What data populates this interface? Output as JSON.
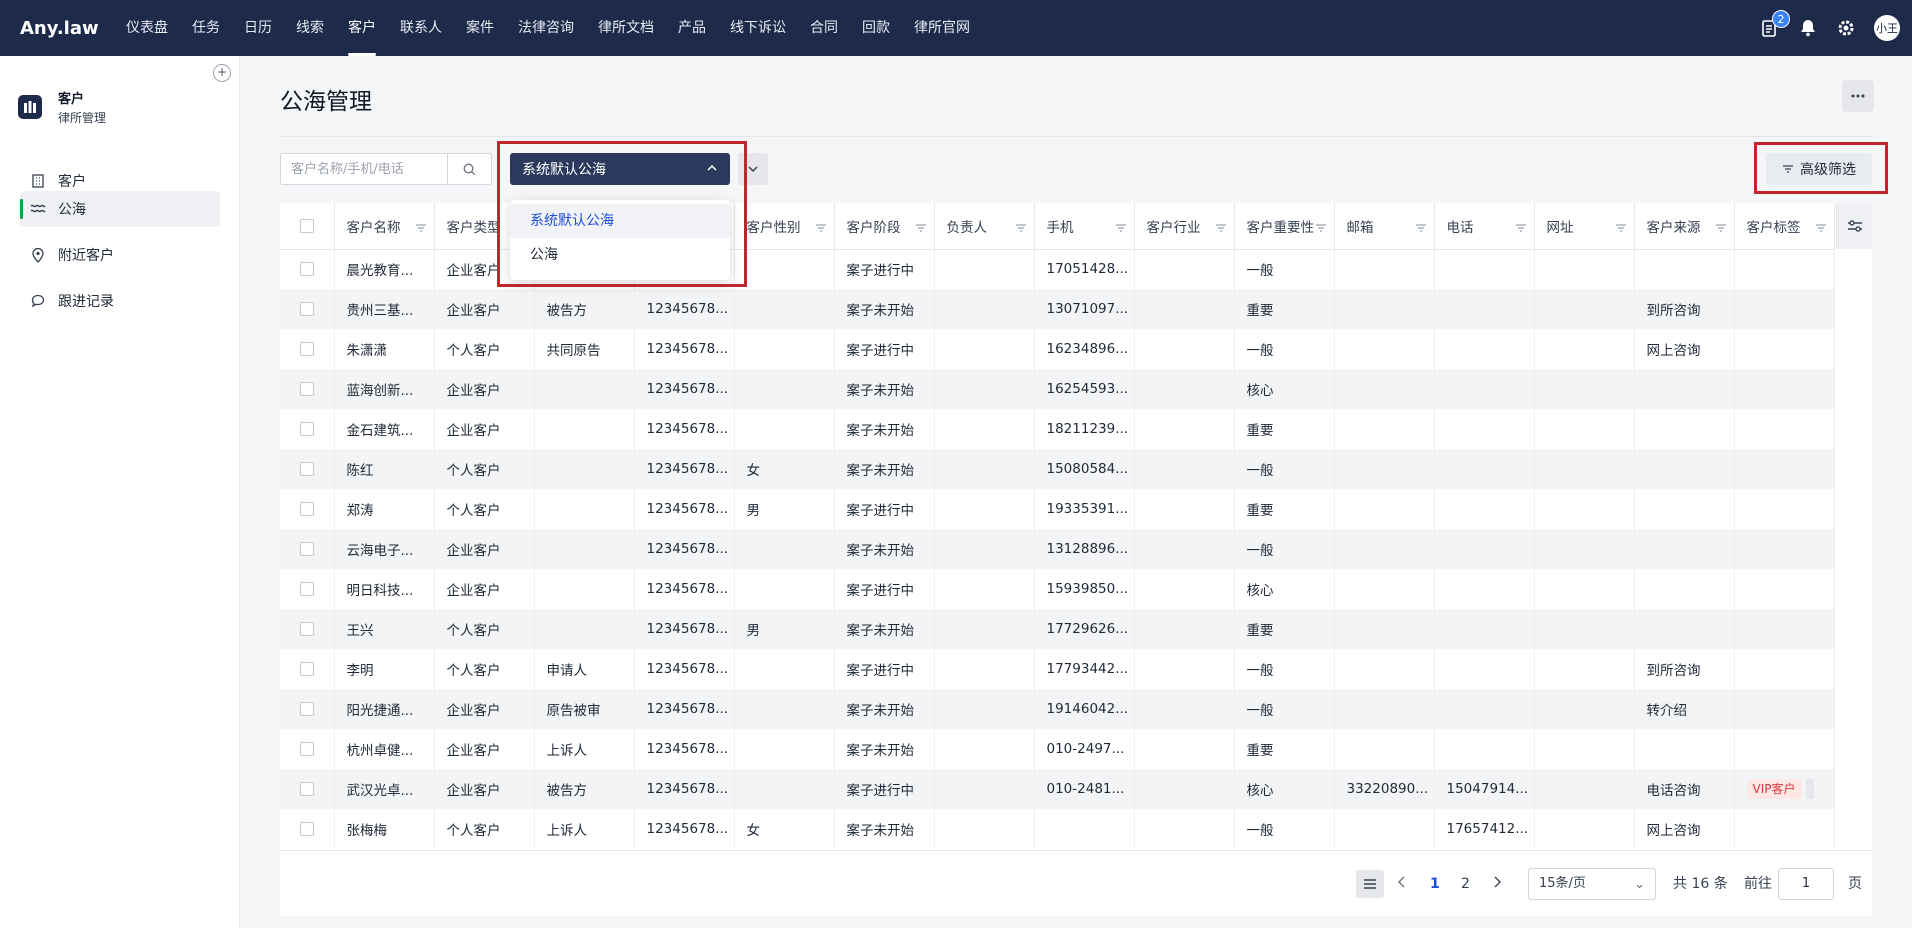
{
  "app": {
    "logo": "Any.law"
  },
  "nav": [
    "仪表盘",
    "任务",
    "日历",
    "线索",
    "客户",
    "联系人",
    "案件",
    "法律咨询",
    "律所文档",
    "产品",
    "线下诉讼",
    "合同",
    "回款",
    "律所官网"
  ],
  "nav_active": "客户",
  "topbar": {
    "badge_count": "2",
    "avatar": "小王"
  },
  "sidebar": {
    "module_title": "客户",
    "module_sub": "律所管理",
    "items": [
      {
        "label": "客户",
        "icon": "building-icon"
      },
      {
        "label": "公海",
        "icon": "waves-icon",
        "active": true
      },
      {
        "label": "附近客户",
        "icon": "location-icon"
      },
      {
        "label": "跟进记录",
        "icon": "chat-icon"
      }
    ]
  },
  "page": {
    "title": "公海管理"
  },
  "filters": {
    "search_placeholder": "客户名称/手机/电话",
    "pool_selected": "系统默认公海",
    "pool_options": [
      "系统默认公海",
      "公海"
    ],
    "advanced_label": "高级筛选"
  },
  "table": {
    "columns": [
      "客户名称",
      "客户类型",
      "",
      "",
      "客户性别",
      "客户阶段",
      "负责人",
      "手机",
      "客户行业",
      "客户重要性",
      "邮箱",
      "电话",
      "网址",
      "客户来源",
      "客户标签"
    ],
    "rows": [
      [
        "晨光教育...",
        "企业客户",
        "",
        "",
        "",
        "案子进行中",
        "",
        "17051428...",
        "",
        "一般",
        "",
        "",
        "",
        "",
        ""
      ],
      [
        "贵州三基...",
        "企业客户",
        "被告方",
        "12345678...",
        "",
        "案子未开始",
        "",
        "13071097...",
        "",
        "重要",
        "",
        "",
        "",
        "到所咨询",
        ""
      ],
      [
        "朱潇潇",
        "个人客户",
        "共同原告",
        "12345678...",
        "",
        "案子进行中",
        "",
        "16234896...",
        "",
        "一般",
        "",
        "",
        "",
        "网上咨询",
        ""
      ],
      [
        "蓝海创新...",
        "企业客户",
        "",
        "12345678...",
        "",
        "案子未开始",
        "",
        "16254593...",
        "",
        "核心",
        "",
        "",
        "",
        "",
        ""
      ],
      [
        "金石建筑...",
        "企业客户",
        "",
        "12345678...",
        "",
        "案子未开始",
        "",
        "18211239...",
        "",
        "重要",
        "",
        "",
        "",
        "",
        ""
      ],
      [
        "陈红",
        "个人客户",
        "",
        "12345678...",
        "女",
        "案子未开始",
        "",
        "15080584...",
        "",
        "一般",
        "",
        "",
        "",
        "",
        ""
      ],
      [
        "郑涛",
        "个人客户",
        "",
        "12345678...",
        "男",
        "案子进行中",
        "",
        "19335391...",
        "",
        "重要",
        "",
        "",
        "",
        "",
        ""
      ],
      [
        "云海电子...",
        "企业客户",
        "",
        "12345678...",
        "",
        "案子未开始",
        "",
        "13128896...",
        "",
        "一般",
        "",
        "",
        "",
        "",
        ""
      ],
      [
        "明日科技...",
        "企业客户",
        "",
        "12345678...",
        "",
        "案子进行中",
        "",
        "15939850...",
        "",
        "核心",
        "",
        "",
        "",
        "",
        ""
      ],
      [
        "王兴",
        "个人客户",
        "",
        "12345678...",
        "男",
        "案子未开始",
        "",
        "17729626...",
        "",
        "重要",
        "",
        "",
        "",
        "",
        ""
      ],
      [
        "李明",
        "个人客户",
        "申请人",
        "12345678...",
        "",
        "案子进行中",
        "",
        "17793442...",
        "",
        "一般",
        "",
        "",
        "",
        "到所咨询",
        ""
      ],
      [
        "阳光捷通...",
        "企业客户",
        "原告被审",
        "12345678...",
        "",
        "案子未开始",
        "",
        "19146042...",
        "",
        "一般",
        "",
        "",
        "",
        "转介绍",
        ""
      ],
      [
        "杭州卓健...",
        "企业客户",
        "上诉人",
        "12345678...",
        "",
        "案子未开始",
        "",
        "010-2497...",
        "",
        "重要",
        "",
        "",
        "",
        "",
        ""
      ],
      [
        "武汉光卓...",
        "企业客户",
        "被告方",
        "12345678...",
        "",
        "案子进行中",
        "",
        "010-2481...",
        "",
        "核心",
        "33220890...",
        "15047914...",
        "",
        "电话咨询",
        "VIP客户"
      ],
      [
        "张梅梅",
        "个人客户",
        "上诉人",
        "12345678...",
        "女",
        "案子未开始",
        "",
        "",
        "",
        "一般",
        "",
        "17657412...",
        "",
        "网上咨询",
        ""
      ]
    ]
  },
  "pagination": {
    "pages": [
      "1",
      "2"
    ],
    "current": "1",
    "page_size": "15条/页",
    "total": "共 16 条",
    "goto_prefix": "前往",
    "goto_value": "1",
    "goto_suffix": "页"
  },
  "colors": {
    "topbar": "#1e2a4a",
    "accent": "#1d4ed8",
    "highlight": "#c0272d",
    "active_marker": "#16a34a"
  }
}
